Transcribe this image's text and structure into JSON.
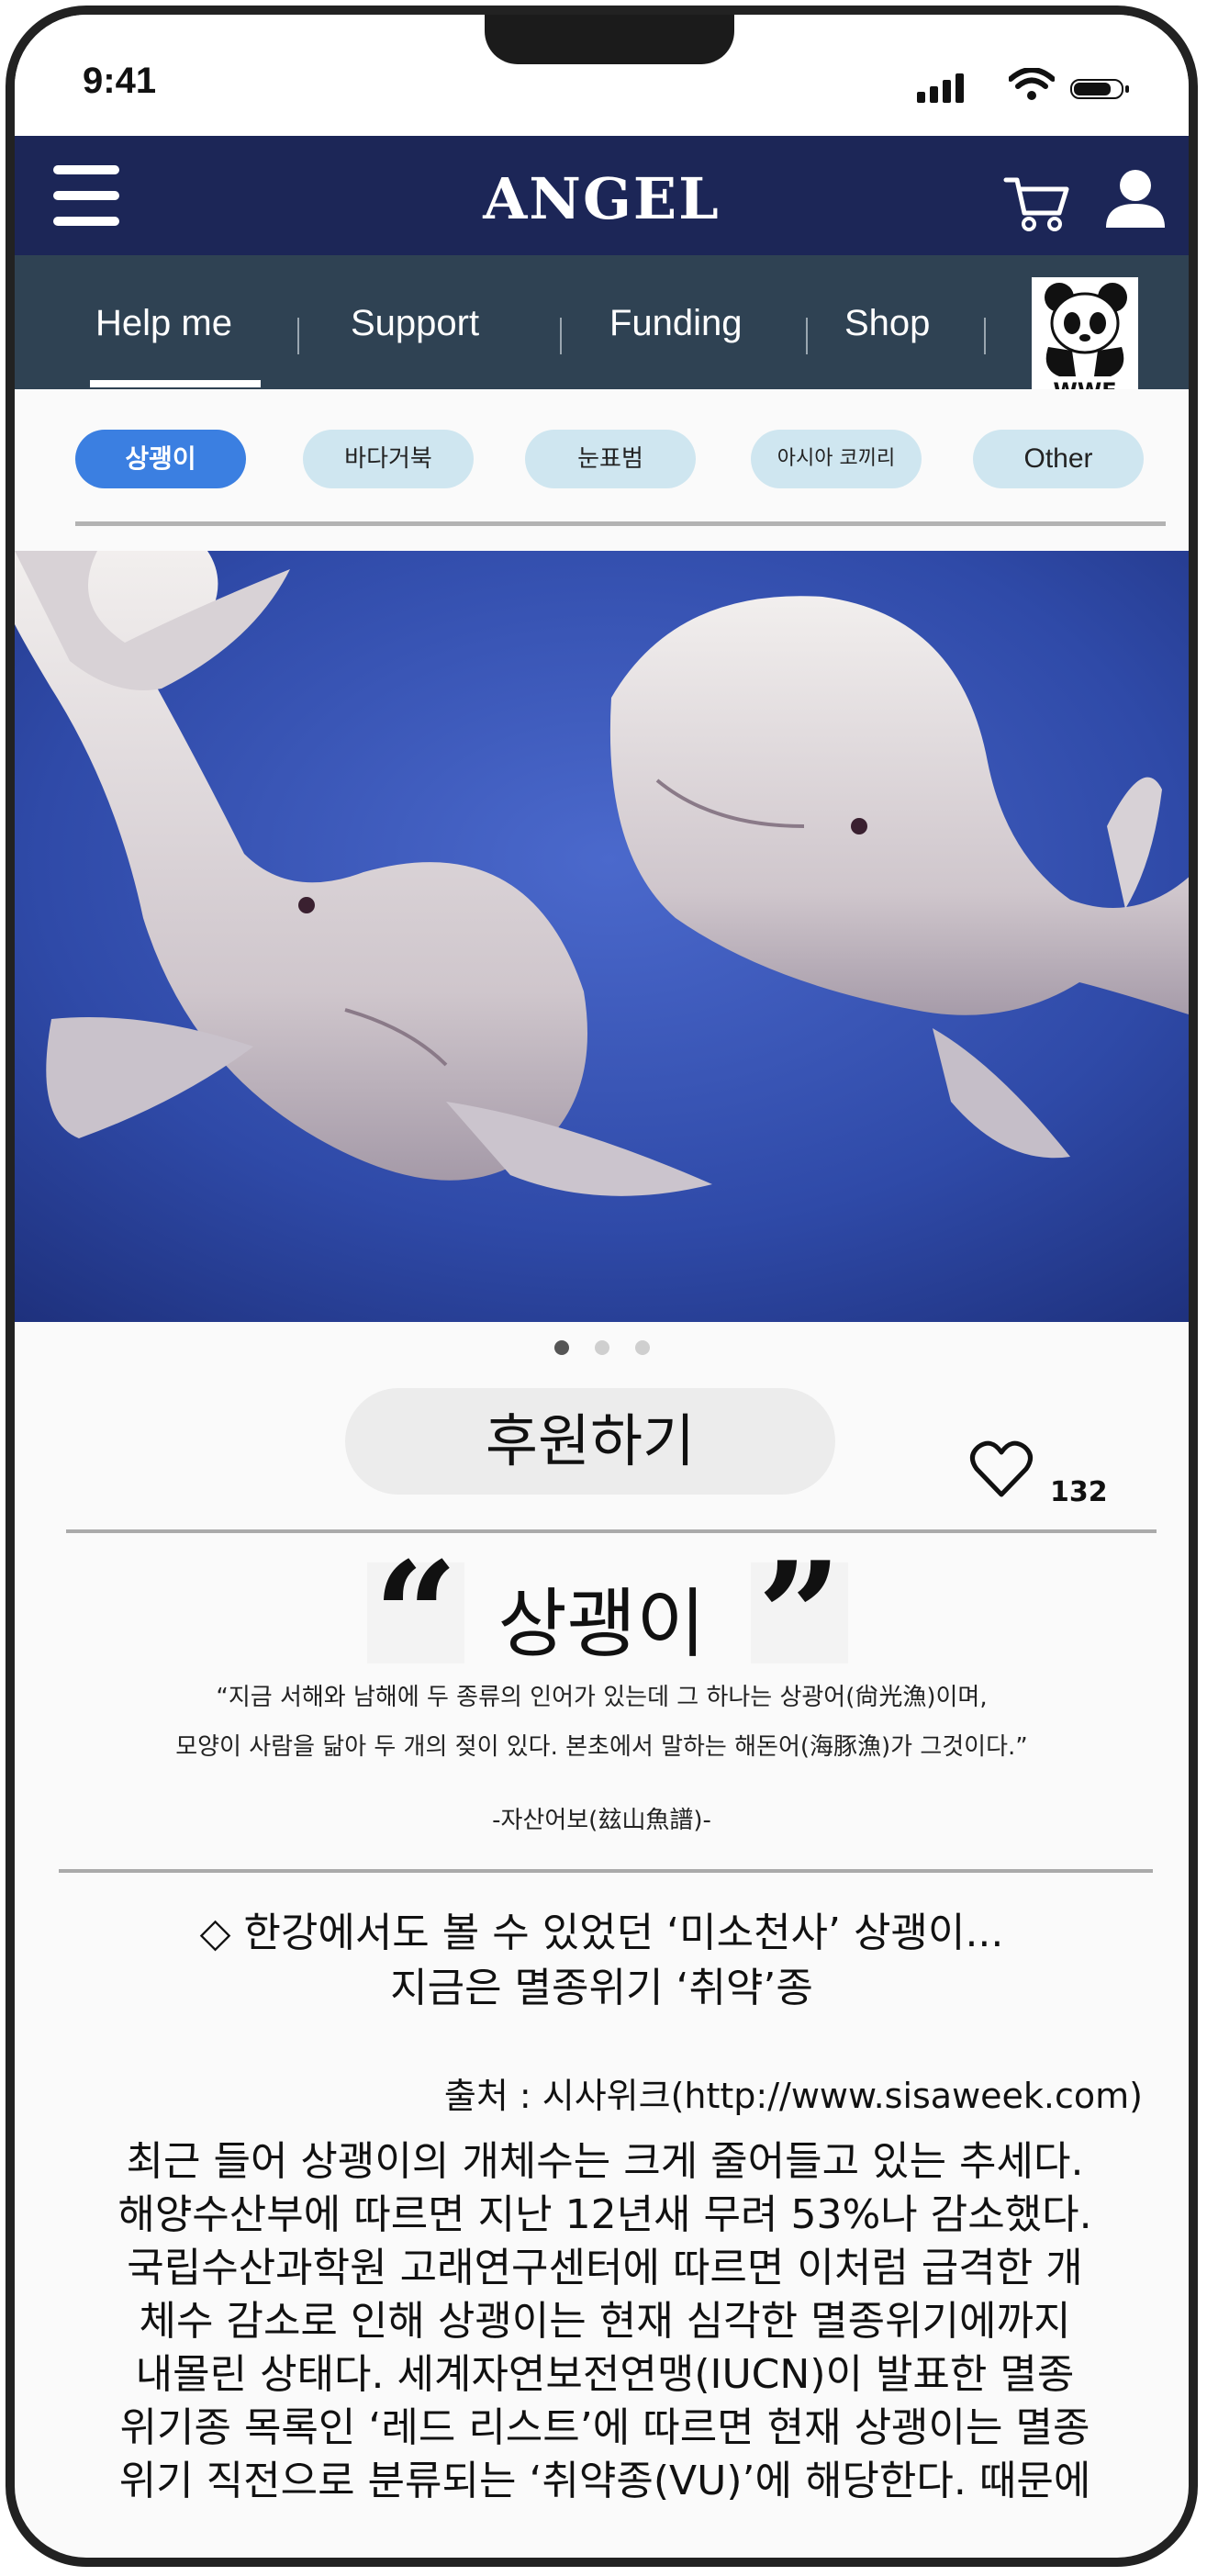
{
  "status_bar": {
    "time": "9:41"
  },
  "header": {
    "brand": "ANGEL"
  },
  "nav": {
    "items": [
      "Help me",
      "Support",
      "Funding",
      "Shop"
    ],
    "active_index": 0,
    "partner_logo_text": "WWF"
  },
  "categories": {
    "items": [
      "상괭이",
      "바다거북",
      "눈표범",
      "아시아 코끼리",
      "Other"
    ],
    "active_index": 0
  },
  "carousel": {
    "slide_count": 3,
    "active_index": 0
  },
  "actions": {
    "donate_label": "후원하기",
    "like_count": "132"
  },
  "article": {
    "title": "상괭이",
    "quote_line1": "“지금 서해와 남해에 두 종류의 인어가 있는데  그 하나는 상광어(尙光漁)이며,",
    "quote_line2": "모양이 사람을 닮아 두 개의 젖이 있다. 본초에서 말하는 해돈어(海豚漁)가 그것이다.”",
    "quote_source": "-자산어보(玆山魚譜)-",
    "headline_line1": "◇ 한강에서도 볼 수 있었던 ‘미소천사’ 상괭이...",
    "headline_line2": "지금은 멸종위기 ‘취약’종",
    "source": "출처 : 시사위크(http://www.sisaweek.com)",
    "body": [
      "최근 들어 상괭이의 개체수는 크게 줄어들고 있는 추세다.",
      "해양수산부에 따르면 지난 12년새 무려 53%나 감소했다.",
      "국립수산과학원 고래연구센터에 따르면 이처럼 급격한 개",
      "체수 감소로 인해 상괭이는 현재 심각한 멸종위기에까지",
      "내몰린 상태다. 세계자연보전연맹(IUCN)이 발표한 멸종",
      "위기종 목록인 ‘레드 리스트’에 따르면 현재 상괭이는 멸종",
      "위기 직전으로 분류되는 ‘취약종(VU)’에 해당한다. 때문에"
    ]
  },
  "colors": {
    "header_bg": "#1c2657",
    "nav_bg": "#2f4253",
    "chip_active": "#3b7fe1",
    "chip_inactive": "#cfe6f0",
    "ocean": "#2f4aa8"
  },
  "icons": [
    "menu-icon",
    "cart-icon",
    "user-icon",
    "heart-icon",
    "quote-open-icon",
    "quote-close-icon"
  ]
}
